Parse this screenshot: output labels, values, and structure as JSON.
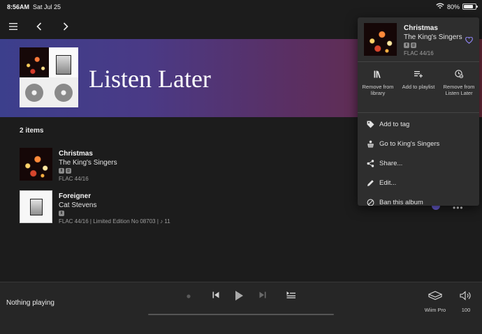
{
  "status": {
    "time": "8:56AM",
    "date": "Sat Jul 25",
    "battery": "80%",
    "battery_level": 0.8
  },
  "page": {
    "title": "Listen Later",
    "count": "2 items"
  },
  "albums": [
    {
      "title": "Christmas",
      "artist": "The King's Singers",
      "quality": "FLAC 44/16",
      "badges": [
        "library-icon",
        "tag-icon"
      ]
    },
    {
      "title": "Foreigner",
      "artist": "Cat Stevens",
      "quality": "FLAC 44/16 | Limited Edition No 08703 | ♪ 11",
      "badges": [
        "library-icon"
      ]
    }
  ],
  "popup": {
    "title": "Christmas",
    "artist": "The King's Singers",
    "quality": "FLAC 44/16",
    "actions": [
      {
        "label": "Remove from library",
        "icon": "library-icon"
      },
      {
        "label": "Add to playlist",
        "icon": "playlist-add-icon"
      },
      {
        "label": "Remove from Listen Later",
        "icon": "listen-later-icon"
      }
    ],
    "menu": [
      {
        "label": "Add to tag",
        "icon": "tag-icon"
      },
      {
        "label": "Go to King's Singers",
        "icon": "artist-icon"
      },
      {
        "label": "Share...",
        "icon": "share-icon"
      },
      {
        "label": "Edit...",
        "icon": "pencil-icon"
      },
      {
        "label": "Ban this album",
        "icon": "ban-icon"
      }
    ]
  },
  "player": {
    "now_playing": "Nothing playing",
    "zone": "Wiim Pro",
    "volume": "100"
  },
  "colors": {
    "accent": "#6b5fd6",
    "heart": "#8e84f0"
  }
}
